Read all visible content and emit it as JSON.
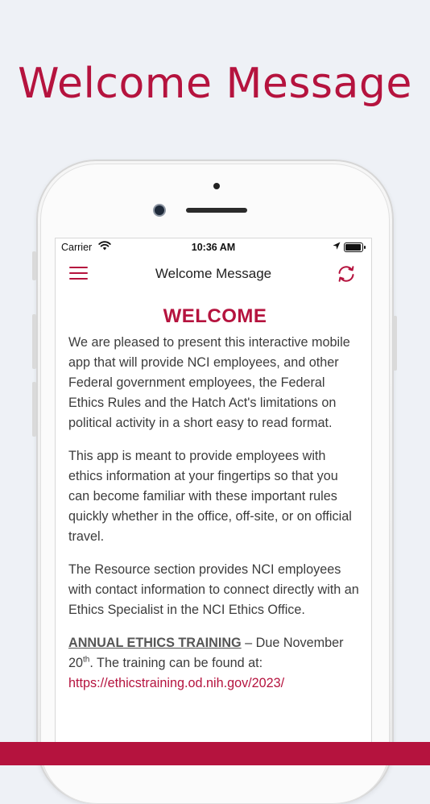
{
  "banner": {
    "title": "Welcome Message"
  },
  "status_bar": {
    "carrier": "Carrier",
    "time": "10:36 AM",
    "battery_level_percent": 95
  },
  "nav": {
    "title": "Welcome Message",
    "menu_icon": "hamburger-icon",
    "refresh_icon": "refresh-icon"
  },
  "content": {
    "heading": "WELCOME",
    "paragraphs": [
      "We are pleased to present this interactive mobile app that will provide NCI employees, and other Federal government employees, the Federal Ethics Rules and the Hatch Act's limitations on political activity in a short easy to read format.",
      "This app is meant to provide employees with ethics information at your fingertips so that you can become familiar with these important rules quickly whether in the office, off-site, or on official travel.",
      "The Resource section provides NCI employees with contact information to connect directly with an Ethics Specialist in the NCI Ethics Office."
    ],
    "training": {
      "title": "ANNUAL ETHICS TRAINING",
      "due_text": " – Due November 20",
      "due_sup": "th",
      "after_text": ".  The training can be found at:",
      "link": "https://ethicstraining.od.nih.gov/2023/"
    }
  },
  "colors": {
    "accent": "#b5133e",
    "background": "#eef1f6"
  }
}
